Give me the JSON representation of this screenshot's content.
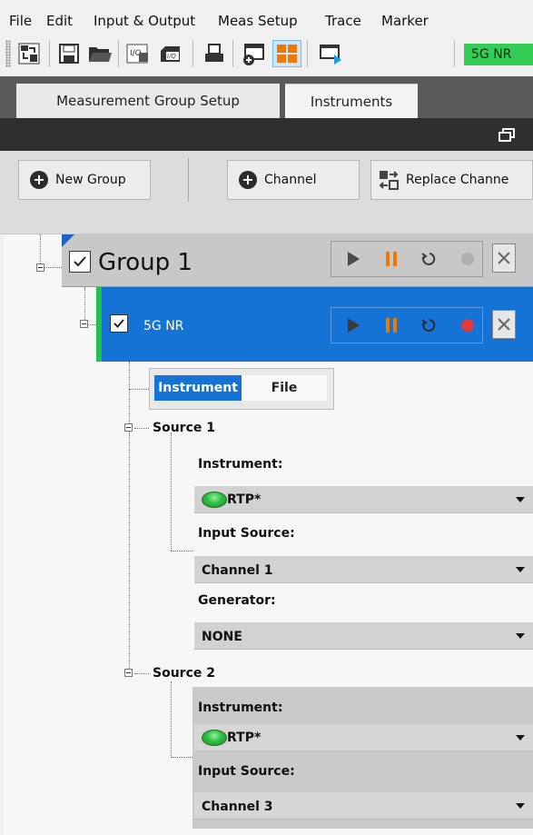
{
  "menu": [
    "File",
    "Edit",
    "Input & Output",
    "Meas Setup",
    "Trace",
    "Marker"
  ],
  "toolbar": {
    "icons": [
      "layout-icon",
      "save-icon",
      "open-folder-icon",
      "io-config-icon",
      "io-file-icon",
      "print-icon",
      "add-window-icon",
      "tile-windows-icon",
      "undock-icon"
    ],
    "active_icon": "tile-windows-icon",
    "badge": "5G NR",
    "badge_color": "#33cc55"
  },
  "tabs": {
    "active": "Measurement Group Setup",
    "inactive": "Instruments"
  },
  "actions": {
    "new_group": "New Group",
    "channel": "Channel",
    "replace_channel": "Replace Channe"
  },
  "group": {
    "name": "Group 1",
    "checked": true
  },
  "channel": {
    "name": "5G NR",
    "checked": true,
    "color": "#1673d6",
    "stripe_color": "#22c24a"
  },
  "source_mode": {
    "options": [
      "Instrument",
      "File"
    ],
    "selected": "Instrument"
  },
  "sources": [
    {
      "title": "Source 1",
      "instrument_label": "Instrument:",
      "instrument_value": "RTP*",
      "input_source_label": "Input Source:",
      "input_source_value": "Channel 1",
      "generator_label": "Generator:",
      "generator_value": "NONE"
    },
    {
      "title": "Source 2",
      "instrument_label": "Instrument:",
      "instrument_value": "RTP*",
      "input_source_label": "Input Source:",
      "input_source_value": "Channel 3"
    }
  ],
  "colors": {
    "accent": "#1673d6",
    "pause": "#f07800",
    "record_active": "#e0393e",
    "record_disabled": "#b0b0b0"
  }
}
